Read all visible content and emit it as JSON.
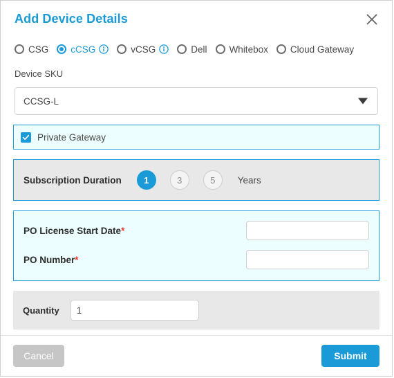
{
  "dialog": {
    "title": "Add Device Details",
    "close_icon": "close-icon"
  },
  "device_type": {
    "options": [
      {
        "label": "CSG",
        "selected": false,
        "info": false
      },
      {
        "label": "cCSG",
        "selected": true,
        "info": true
      },
      {
        "label": "vCSG",
        "selected": false,
        "info": true
      },
      {
        "label": "Dell",
        "selected": false,
        "info": false
      },
      {
        "label": "Whitebox",
        "selected": false,
        "info": false
      },
      {
        "label": "Cloud Gateway",
        "selected": false,
        "info": false
      }
    ]
  },
  "device_sku": {
    "label": "Device SKU",
    "value": "CCSG-L",
    "arrow_icon": "chevron-down-icon"
  },
  "private_gateway": {
    "label": "Private Gateway",
    "checked": true,
    "check_icon": "check-icon"
  },
  "subscription": {
    "title": "Subscription Duration",
    "durations": [
      "1",
      "3",
      "5"
    ],
    "selected": "1",
    "unit_label": "Years"
  },
  "po": {
    "license_start_date_label": "PO License Start Date",
    "license_start_date_value": "",
    "license_start_date_placeholder": "",
    "po_number_label": "PO Number",
    "po_number_value": "",
    "po_number_placeholder": "",
    "required_marker": "*"
  },
  "quantity": {
    "label": "Quantity",
    "value": "1",
    "placeholder": ""
  },
  "footer": {
    "cancel_label": "Cancel",
    "submit_label": "Submit"
  },
  "colors": {
    "accent": "#1a9ad7",
    "panel_cyan": "#ecfeff",
    "panel_gray": "#e8e8e8",
    "required_red": "#e8342a",
    "cancel_gray": "#c6c6c6"
  }
}
